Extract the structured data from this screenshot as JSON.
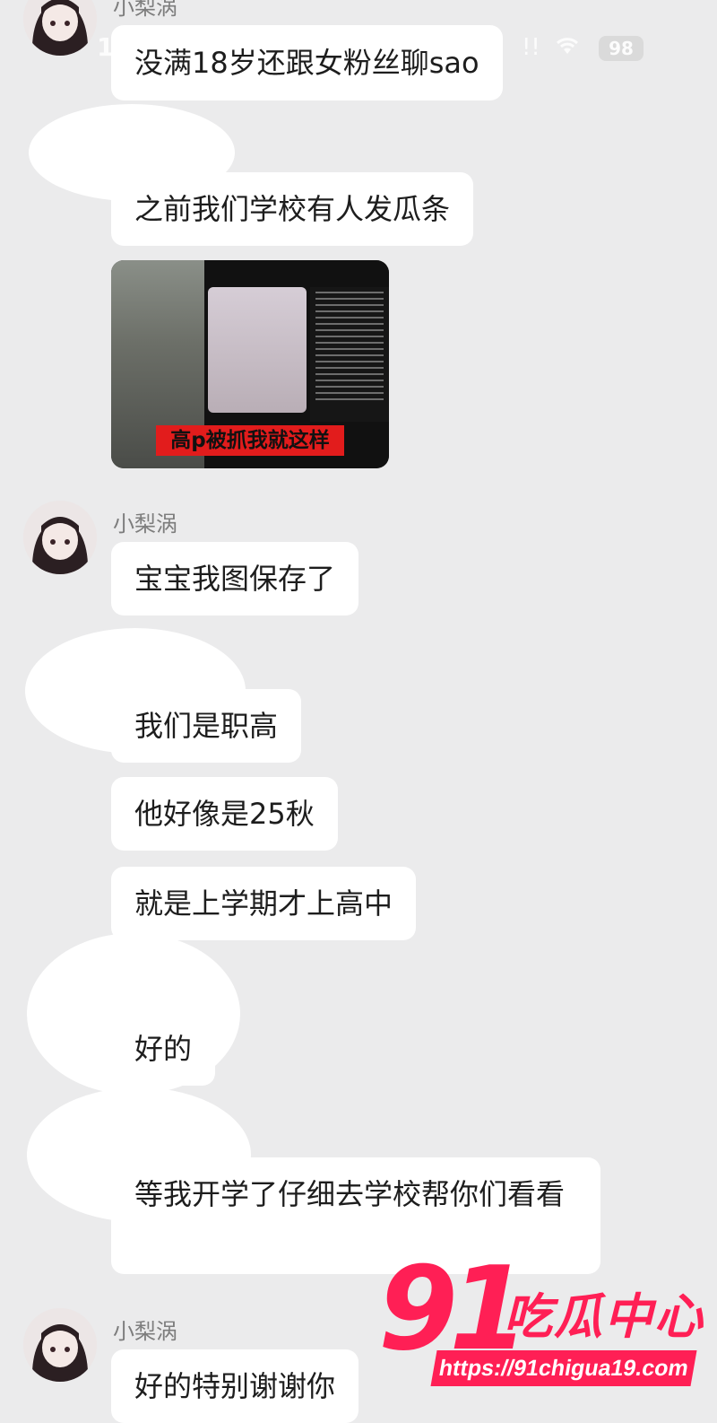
{
  "status_bar": {
    "time": "1",
    "signal": "!!",
    "battery": "98"
  },
  "messages": [
    {
      "sender": "小梨涡",
      "text": "没满18岁还跟女粉丝聊sao"
    },
    {
      "sender": "",
      "text": "之前我们学校有人发瓜条"
    },
    {
      "sender": "",
      "image_caption": "高p被抓我就这样"
    },
    {
      "sender": "小梨涡",
      "text": "宝宝我图保存了"
    },
    {
      "sender": "",
      "text": "我们是职高"
    },
    {
      "sender": "",
      "text": "他好像是25秋"
    },
    {
      "sender": "",
      "text": "就是上学期才上高中"
    },
    {
      "sender": "",
      "text": "好的"
    },
    {
      "sender": "",
      "text": "等我开学了仔细去学校帮你们看看"
    },
    {
      "sender": "小梨涡",
      "text": "好的特别谢谢你"
    }
  ],
  "watermark": {
    "number": "91",
    "brand": "吃瓜中心",
    "url": "https://91chigua19.com"
  },
  "colors": {
    "background": "#ebebec",
    "bubble": "#ffffff",
    "watermark": "#ff1f55",
    "caption_bg": "#e21c1c"
  }
}
